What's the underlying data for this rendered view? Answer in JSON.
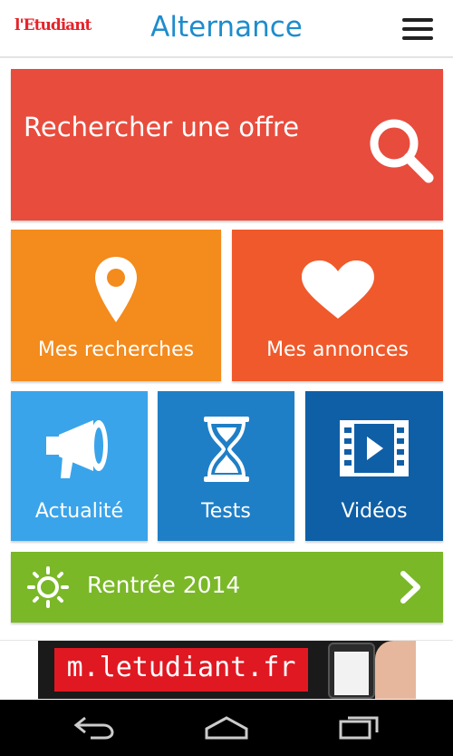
{
  "header": {
    "logo": "l'Etudiant",
    "title": "Alternance",
    "menu_icon": "hamburger-menu-icon"
  },
  "tiles": {
    "search": {
      "label": "Rechercher une offre",
      "icon": "search-icon",
      "color": "#e84c3d"
    },
    "recherches": {
      "label": "Mes recherches",
      "icon": "map-pin-icon",
      "color": "#f38b1d"
    },
    "annonces": {
      "label": "Mes annonces",
      "icon": "heart-icon",
      "color": "#f0592b"
    },
    "actualite": {
      "label": "Actualité",
      "icon": "megaphone-icon",
      "color": "#3aa4ea"
    },
    "tests": {
      "label": "Tests",
      "icon": "hourglass-icon",
      "color": "#1f7fc6"
    },
    "videos": {
      "label": "Vidéos",
      "icon": "film-play-icon",
      "color": "#0f5fa6"
    },
    "rentree": {
      "label": "Rentrée 2014",
      "icon": "sun-icon",
      "arrow_icon": "chevron-right-icon",
      "color": "#7ab827"
    }
  },
  "ad": {
    "text": "m.letudiant.fr"
  },
  "navbar": {
    "back_icon": "back-icon",
    "home_icon": "home-icon",
    "recents_icon": "recent-apps-icon"
  }
}
